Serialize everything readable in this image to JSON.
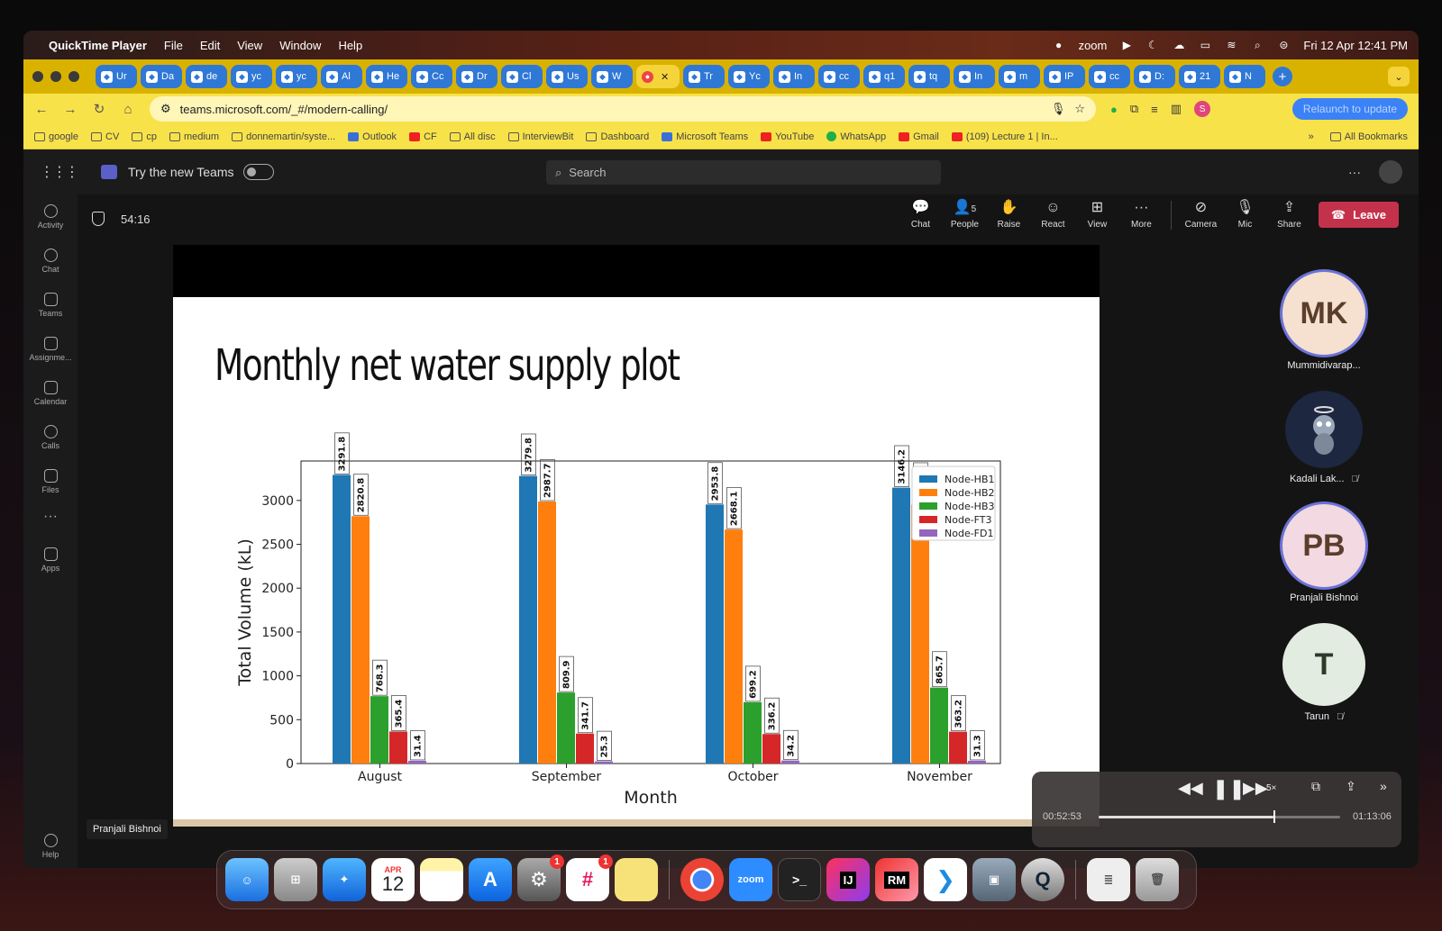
{
  "menubar": {
    "app": "QuickTime Player",
    "menus": [
      "File",
      "Edit",
      "View",
      "Window",
      "Help"
    ],
    "zoom_label": "zoom",
    "datetime": "Fri 12 Apr  12:41 PM"
  },
  "tabs": [
    "Ur",
    "Da",
    "de",
    "yc",
    "yc",
    "Al",
    "He",
    "Cc",
    "Dr",
    "Cl",
    "Us",
    "W",
    "",
    "Tr",
    "Yc",
    "In",
    "cc",
    "q1",
    "tq",
    "In",
    "m",
    "IP",
    "cc",
    "D:",
    "21",
    "N"
  ],
  "browser": {
    "url": "teams.microsoft.com/_#/modern-calling/",
    "relaunch": "Relaunch to update"
  },
  "bookmarks": [
    "google",
    "CV",
    "cp",
    "medium",
    "donnemartin/syste...",
    "Outlook",
    "CF",
    "All disc",
    "InterviewBit",
    "Dashboard",
    "Microsoft Teams",
    "YouTube",
    "WhatsApp",
    "Gmail",
    "(109) Lecture 1 | In..."
  ],
  "bookmarks_more": "»",
  "all_bookmarks": "All Bookmarks",
  "teams": {
    "try_new": "Try the new Teams",
    "search_placeholder": "Search",
    "rail": [
      "Activity",
      "Chat",
      "Teams",
      "Assignme...",
      "Calendar",
      "Calls",
      "Files"
    ],
    "rail_more": "···",
    "apps": "Apps",
    "help": "Help"
  },
  "meeting": {
    "timer": "54:16",
    "controls": {
      "chat": "Chat",
      "people": "People",
      "people_count": "5",
      "raise": "Raise",
      "react": "React",
      "view": "View",
      "more": "More",
      "camera": "Camera",
      "mic": "Mic",
      "share": "Share",
      "leave": "Leave"
    },
    "presenter": "Pranjali Bishnoi",
    "participants": [
      {
        "initials": "MK",
        "name": "Mummidivarap...",
        "muted": false,
        "color": "#f6e0cf",
        "ring": "#6b72d6"
      },
      {
        "initials": "",
        "name": "Kadali Lak...",
        "muted": true,
        "color": "#1d2740",
        "ring": ""
      },
      {
        "initials": "PB",
        "name": "Pranjali Bishnoi",
        "muted": false,
        "color": "#f3d9e1",
        "ring": "#6b72d6"
      },
      {
        "initials": "T",
        "name": "Tarun",
        "muted": true,
        "color": "#e3ece0",
        "ring": ""
      }
    ]
  },
  "slide": {
    "title": "Monthly net water supply plot"
  },
  "chart_data": {
    "type": "bar",
    "categories": [
      "August",
      "September",
      "October",
      "November"
    ],
    "series": [
      {
        "name": "Node-HB1",
        "color": "#1f77b4",
        "values": [
          3291.8,
          3279.8,
          2953.8,
          3146.2
        ]
      },
      {
        "name": "Node-HB2",
        "color": "#ff7f0e",
        "values": [
          2820.8,
          2987.7,
          2668.1,
          2951.4
        ]
      },
      {
        "name": "Node-HB3",
        "color": "#2ca02c",
        "values": [
          768.3,
          809.9,
          699.2,
          865.7
        ]
      },
      {
        "name": "Node-FT3",
        "color": "#d62728",
        "values": [
          365.4,
          341.7,
          336.2,
          363.2
        ]
      },
      {
        "name": "Node-FD1",
        "color": "#9467bd",
        "values": [
          31.4,
          25.3,
          34.2,
          31.3
        ]
      }
    ],
    "xlabel": "Month",
    "ylabel": "Total Volume (kL)",
    "ylim": [
      0,
      3450
    ],
    "yticks": [
      0,
      500,
      1000,
      1500,
      2000,
      2500,
      3000
    ],
    "legend": "top-right",
    "grid": false
  },
  "quicktime": {
    "elapsed": "00:52:53",
    "total": "01:13:06",
    "speed": "5×",
    "progress": 0.7235
  },
  "dock": {
    "calendar_month": "APR",
    "calendar_day": "12",
    "zoom": "zoom",
    "ij": "IJ",
    "rm": "RM",
    "badge1": "1",
    "badge2": "1"
  }
}
